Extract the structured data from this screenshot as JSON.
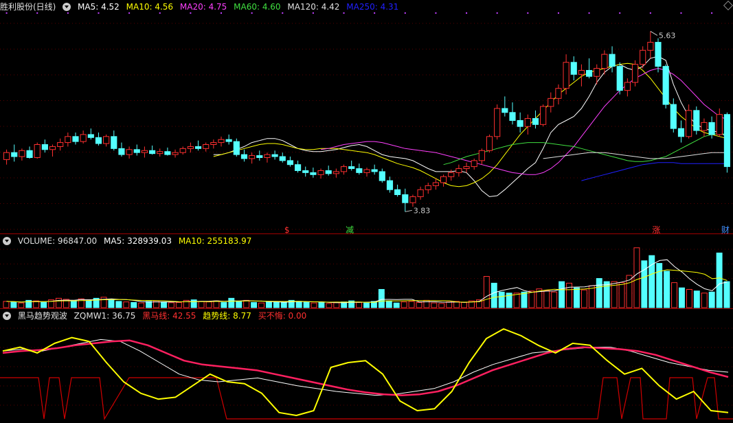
{
  "header_price": {
    "title": "胜利股份(日线)",
    "items": [
      {
        "label": "MA5: 4.52",
        "color": "#ffffff"
      },
      {
        "label": "MA10: 4.56",
        "color": "#ffff00"
      },
      {
        "label": "MA20: 4.75",
        "color": "#ff40ff"
      },
      {
        "label": "MA60: 4.60",
        "color": "#40e040"
      },
      {
        "label": "MA120: 4.42",
        "color": "#e0e0e0"
      },
      {
        "label": "MA250: 4.31",
        "color": "#2020ff"
      }
    ]
  },
  "header_volume": {
    "items": [
      {
        "label": "VOLUME: 96847.00",
        "color": "#e0e0e0"
      },
      {
        "label": "MA5: 328939.03",
        "color": "#ffffff"
      },
      {
        "label": "MA10: 255183.97",
        "color": "#ffff00"
      }
    ]
  },
  "header_indicator": {
    "items": [
      {
        "label": "黑马趋势观波",
        "color": "#e0e0e0"
      },
      {
        "label": "ZQMW1: 36.75",
        "color": "#e0e0e0"
      },
      {
        "label": "黑马线: 42.55",
        "color": "#ff3030"
      },
      {
        "label": "趋势线: 8.77",
        "color": "#ffff00"
      },
      {
        "label": "买不悔: 0.00",
        "color": "#ff3030"
      }
    ]
  },
  "annotations": {
    "high_label": "5.63",
    "low_label": "3.83",
    "markers": [
      {
        "text": "$",
        "color": "#ff3030"
      },
      {
        "text": "减",
        "color": "#40e040"
      },
      {
        "text": "涨",
        "color": "#ff3030"
      },
      {
        "text": "财",
        "color": "#4090ff"
      }
    ]
  },
  "chart_data": [
    {
      "type": "candlestick",
      "title": "胜利股份(日线)",
      "ylim": [
        3.75,
        5.75
      ],
      "candles": [
        [
          4.35,
          4.45,
          4.3,
          4.42
        ],
        [
          4.42,
          4.5,
          4.33,
          4.38
        ],
        [
          4.38,
          4.46,
          4.34,
          4.44
        ],
        [
          4.44,
          4.48,
          4.36,
          4.37
        ],
        [
          4.37,
          4.52,
          4.36,
          4.5
        ],
        [
          4.5,
          4.55,
          4.42,
          4.45
        ],
        [
          4.45,
          4.5,
          4.38,
          4.48
        ],
        [
          4.48,
          4.56,
          4.44,
          4.52
        ],
        [
          4.52,
          4.62,
          4.48,
          4.58
        ],
        [
          4.58,
          4.62,
          4.5,
          4.53
        ],
        [
          4.53,
          4.64,
          4.51,
          4.6
        ],
        [
          4.6,
          4.66,
          4.55,
          4.57
        ],
        [
          4.57,
          4.62,
          4.49,
          4.51
        ],
        [
          4.51,
          4.6,
          4.48,
          4.58
        ],
        [
          4.58,
          4.64,
          4.44,
          4.46
        ],
        [
          4.46,
          4.52,
          4.38,
          4.4
        ],
        [
          4.4,
          4.48,
          4.36,
          4.45
        ],
        [
          4.45,
          4.5,
          4.39,
          4.42
        ],
        [
          4.42,
          4.48,
          4.37,
          4.44
        ],
        [
          4.44,
          4.49,
          4.4,
          4.41
        ],
        [
          4.41,
          4.46,
          4.38,
          4.43
        ],
        [
          4.43,
          4.47,
          4.39,
          4.4
        ],
        [
          4.4,
          4.45,
          4.37,
          4.42
        ],
        [
          4.42,
          4.48,
          4.4,
          4.46
        ],
        [
          4.46,
          4.52,
          4.42,
          4.48
        ],
        [
          4.48,
          4.54,
          4.44,
          4.46
        ],
        [
          4.46,
          4.52,
          4.43,
          4.5
        ],
        [
          4.5,
          4.55,
          4.46,
          4.52
        ],
        [
          4.52,
          4.58,
          4.48,
          4.55
        ],
        [
          4.55,
          4.6,
          4.5,
          4.53
        ],
        [
          4.53,
          4.56,
          4.38,
          4.4
        ],
        [
          4.4,
          4.45,
          4.33,
          4.36
        ],
        [
          4.36,
          4.42,
          4.31,
          4.39
        ],
        [
          4.39,
          4.44,
          4.34,
          4.37
        ],
        [
          4.37,
          4.42,
          4.32,
          4.4
        ],
        [
          4.4,
          4.44,
          4.35,
          4.38
        ],
        [
          4.38,
          4.42,
          4.32,
          4.34
        ],
        [
          4.34,
          4.38,
          4.28,
          4.3
        ],
        [
          4.3,
          4.34,
          4.22,
          4.24
        ],
        [
          4.24,
          4.28,
          4.18,
          4.22
        ],
        [
          4.22,
          4.27,
          4.17,
          4.2
        ],
        [
          4.2,
          4.26,
          4.16,
          4.24
        ],
        [
          4.24,
          4.29,
          4.19,
          4.21
        ],
        [
          4.21,
          4.26,
          4.17,
          4.23
        ],
        [
          4.23,
          4.3,
          4.2,
          4.28
        ],
        [
          4.28,
          4.34,
          4.24,
          4.26
        ],
        [
          4.26,
          4.31,
          4.2,
          4.22
        ],
        [
          4.22,
          4.27,
          4.18,
          4.25
        ],
        [
          4.25,
          4.3,
          4.2,
          4.23
        ],
        [
          4.23,
          4.26,
          4.12,
          4.14
        ],
        [
          4.14,
          4.18,
          4.02,
          4.05
        ],
        [
          4.05,
          4.1,
          3.98,
          4.0
        ],
        [
          4.0,
          4.06,
          3.83,
          3.92
        ],
        [
          3.92,
          4.0,
          3.88,
          3.98
        ],
        [
          3.98,
          4.08,
          3.95,
          4.05
        ],
        [
          4.05,
          4.12,
          4.01,
          4.09
        ],
        [
          4.09,
          4.16,
          4.05,
          4.12
        ],
        [
          4.12,
          4.2,
          4.08,
          4.18
        ],
        [
          4.18,
          4.25,
          4.14,
          4.22
        ],
        [
          4.22,
          4.3,
          4.18,
          4.26
        ],
        [
          4.26,
          4.32,
          4.22,
          4.28
        ],
        [
          4.28,
          4.36,
          4.25,
          4.34
        ],
        [
          4.34,
          4.46,
          4.3,
          4.44
        ],
        [
          4.44,
          4.6,
          4.42,
          4.58
        ],
        [
          4.58,
          4.9,
          4.55,
          4.86
        ],
        [
          4.86,
          4.98,
          4.78,
          4.82
        ],
        [
          4.82,
          4.92,
          4.7,
          4.74
        ],
        [
          4.74,
          4.82,
          4.62,
          4.68
        ],
        [
          4.68,
          4.8,
          4.6,
          4.76
        ],
        [
          4.76,
          4.84,
          4.66,
          4.7
        ],
        [
          4.7,
          4.9,
          4.68,
          4.88
        ],
        [
          4.88,
          5.02,
          4.82,
          4.96
        ],
        [
          4.96,
          5.1,
          4.9,
          5.06
        ],
        [
          5.06,
          5.4,
          5.0,
          5.32
        ],
        [
          5.32,
          5.38,
          5.14,
          5.2
        ],
        [
          5.2,
          5.3,
          5.08,
          5.24
        ],
        [
          5.24,
          5.36,
          5.16,
          5.18
        ],
        [
          5.18,
          5.3,
          5.1,
          5.26
        ],
        [
          5.26,
          5.44,
          5.2,
          5.4
        ],
        [
          5.4,
          5.48,
          5.22,
          5.28
        ],
        [
          5.28,
          5.32,
          5.0,
          5.04
        ],
        [
          5.04,
          5.16,
          4.98,
          5.12
        ],
        [
          5.12,
          5.34,
          5.08,
          5.3
        ],
        [
          5.3,
          5.48,
          5.26,
          5.44
        ],
        [
          5.44,
          5.63,
          5.36,
          5.52
        ],
        [
          5.52,
          5.56,
          5.22,
          5.28
        ],
        [
          5.28,
          5.3,
          4.86,
          4.9
        ],
        [
          4.9,
          4.96,
          4.62,
          4.66
        ],
        [
          4.66,
          4.74,
          4.52,
          4.58
        ],
        [
          4.58,
          4.9,
          4.56,
          4.84
        ],
        [
          4.84,
          4.88,
          4.6,
          4.64
        ],
        [
          4.64,
          4.76,
          4.58,
          4.72
        ],
        [
          4.72,
          4.78,
          4.56,
          4.6
        ],
        [
          4.6,
          4.86,
          4.58,
          4.8
        ],
        [
          4.8,
          4.82,
          4.22,
          4.28
        ]
      ],
      "ma": [
        {
          "name": "MA5",
          "color": "#ffffff",
          "values": [
            4.4,
            4.4,
            4.42,
            4.45,
            4.48,
            4.52,
            4.54,
            4.56,
            4.56,
            4.54,
            4.5,
            4.46,
            4.44,
            4.43,
            4.43,
            4.44,
            4.45,
            4.47,
            4.49,
            4.5,
            4.48,
            4.44,
            4.4,
            4.38,
            4.37,
            4.36,
            4.34,
            4.3,
            4.26,
            4.23,
            4.23,
            4.23,
            4.24,
            4.22,
            4.14,
            4.04,
            3.98,
            3.99,
            4.05,
            4.12,
            4.19,
            4.26,
            4.32,
            4.46,
            4.62,
            4.7,
            4.74,
            4.78,
            4.86,
            4.98,
            5.12,
            5.22,
            5.28,
            5.3,
            5.26,
            5.24,
            5.28,
            5.36,
            5.38,
            5.34,
            5.1,
            4.92,
            4.78,
            4.7,
            4.66,
            4.64,
            4.62,
            4.58
          ]
        },
        {
          "name": "MA10",
          "color": "#ffff00",
          "values": [
            4.38,
            4.4,
            4.42,
            4.44,
            4.46,
            4.48,
            4.5,
            4.51,
            4.51,
            4.5,
            4.48,
            4.46,
            4.45,
            4.45,
            4.46,
            4.46,
            4.46,
            4.45,
            4.44,
            4.43,
            4.42,
            4.4,
            4.37,
            4.34,
            4.31,
            4.29,
            4.27,
            4.24,
            4.2,
            4.16,
            4.12,
            4.09,
            4.08,
            4.09,
            4.12,
            4.16,
            4.22,
            4.3,
            4.4,
            4.5,
            4.6,
            4.68,
            4.76,
            4.84,
            4.92,
            5.0,
            5.06,
            5.12,
            5.18,
            5.22,
            5.24,
            5.26,
            5.28,
            5.3,
            5.31,
            5.3,
            5.24,
            5.16,
            5.06,
            4.96,
            4.86,
            4.78,
            4.72,
            4.66,
            4.62,
            4.6,
            4.58,
            4.56
          ]
        },
        {
          "name": "MA20",
          "color": "#ff40ff",
          "values": [
            4.45,
            4.46,
            4.48,
            4.5,
            4.51,
            4.52,
            4.53,
            4.53,
            4.52,
            4.5,
            4.48,
            4.46,
            4.45,
            4.44,
            4.43,
            4.42,
            4.4,
            4.38,
            4.36,
            4.34,
            4.32,
            4.3,
            4.28,
            4.26,
            4.24,
            4.22,
            4.21,
            4.2,
            4.2,
            4.22,
            4.26,
            4.32,
            4.4,
            4.48,
            4.58,
            4.68,
            4.78,
            4.88,
            4.96,
            5.04,
            5.1,
            5.16,
            5.2,
            5.24,
            5.26,
            5.24,
            5.2,
            5.14,
            5.06,
            4.98,
            4.9,
            4.84,
            4.78,
            4.75
          ]
        },
        {
          "name": "MA60",
          "color": "#40e040",
          "values": [
            4.3,
            4.32,
            4.35,
            4.38,
            4.4,
            4.42,
            4.44,
            4.46,
            4.48,
            4.5,
            4.51,
            4.52,
            4.52,
            4.52,
            4.51,
            4.5,
            4.49,
            4.48,
            4.46,
            4.44,
            4.42,
            4.4,
            4.38,
            4.36,
            4.34,
            4.33,
            4.33,
            4.34,
            4.36,
            4.38,
            4.42,
            4.46,
            4.5,
            4.54,
            4.58,
            4.6,
            4.61,
            4.6
          ]
        },
        {
          "name": "MA120",
          "color": "#e0e0e0",
          "values": [
            4.36,
            4.37,
            4.38,
            4.39,
            4.4,
            4.41,
            4.42,
            4.42,
            4.42,
            4.41,
            4.4,
            4.39,
            4.38,
            4.37,
            4.36,
            4.36,
            4.36,
            4.37,
            4.38,
            4.39,
            4.4,
            4.41,
            4.42,
            4.42,
            4.42
          ]
        },
        {
          "name": "MA250",
          "color": "#2020ff",
          "values": [
            4.14,
            4.16,
            4.18,
            4.2,
            4.22,
            4.24,
            4.26,
            4.28,
            4.3,
            4.31,
            4.32,
            4.32,
            4.32,
            4.31,
            4.31,
            4.31,
            4.31,
            4.31,
            4.31,
            4.31
          ]
        }
      ]
    },
    {
      "type": "bar",
      "title": "VOLUME",
      "ylim": [
        0,
        1200000
      ],
      "values": [
        120000,
        110000,
        90000,
        140000,
        130000,
        100000,
        150000,
        180000,
        160000,
        120000,
        170000,
        130000,
        180000,
        200000,
        160000,
        120000,
        110000,
        100000,
        90000,
        120000,
        130000,
        110000,
        95000,
        100000,
        140000,
        150000,
        120000,
        110000,
        130000,
        100000,
        180000,
        120000,
        140000,
        100000,
        90000,
        120000,
        110000,
        100000,
        140000,
        120000,
        110000,
        90000,
        100000,
        80000,
        95000,
        110000,
        130000,
        100000,
        90000,
        120000,
        350000,
        130000,
        90000,
        110000,
        120000,
        100000,
        140000,
        90000,
        80000,
        110000,
        120000,
        100000,
        130000,
        150000,
        600000,
        470000,
        300000,
        280000,
        280000,
        300000,
        320000,
        360000,
        330000,
        300000,
        500000,
        470000,
        380000,
        340000,
        420000,
        560000,
        500000,
        500000,
        480000,
        620000,
        1150000,
        900000,
        1000000,
        850000,
        700000,
        480000,
        380000,
        350000,
        320000,
        280000,
        300000,
        1050000,
        500000
      ],
      "ma": [
        {
          "name": "MA5",
          "color": "#ffffff"
        },
        {
          "name": "MA10",
          "color": "#ffff00"
        }
      ]
    },
    {
      "type": "line",
      "title": "黑马趋势观波",
      "ylim": [
        0,
        100
      ],
      "series": [
        {
          "name": "ZQMW1",
          "color": "#ffffff",
          "values": [
            72,
            74,
            72,
            76,
            80,
            84,
            82,
            72,
            60,
            48,
            42,
            40,
            42,
            44,
            40,
            36,
            33,
            30,
            28,
            26,
            27,
            30,
            33,
            40,
            50,
            58,
            64,
            70,
            72,
            74,
            76,
            76,
            72,
            66,
            60,
            56,
            52,
            50
          ]
        },
        {
          "name": "黑马线",
          "color": "#ff2060",
          "values": [
            70,
            72,
            73,
            75,
            78,
            80,
            82,
            83,
            78,
            70,
            62,
            58,
            56,
            54,
            52,
            48,
            44,
            40,
            36,
            32,
            29,
            27,
            26,
            27,
            30,
            36,
            44,
            52,
            58,
            64,
            70,
            74,
            76,
            75,
            74,
            72,
            68,
            62,
            56,
            50,
            45
          ]
        },
        {
          "name": "趋势线",
          "color": "#ffff00",
          "values": [
            72,
            76,
            70,
            80,
            86,
            82,
            60,
            40,
            28,
            22,
            24,
            36,
            48,
            40,
            38,
            28,
            8,
            5,
            10,
            55,
            60,
            62,
            48,
            20,
            10,
            12,
            30,
            60,
            85,
            95,
            88,
            78,
            70,
            80,
            78,
            62,
            48,
            54,
            36,
            22,
            30,
            10,
            8
          ]
        },
        {
          "name": "买不悔",
          "color": "#ff3030"
        }
      ]
    }
  ]
}
